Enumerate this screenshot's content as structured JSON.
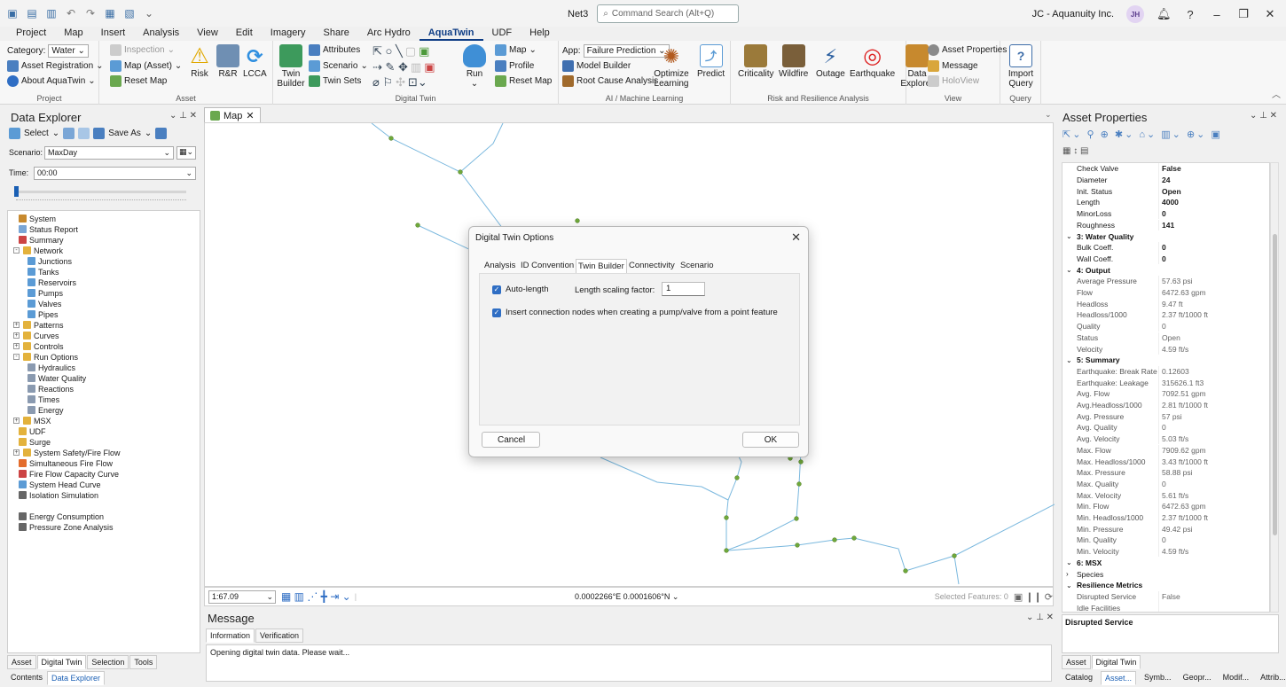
{
  "titlebar": {
    "project": "Net3",
    "search_placeholder": "Command Search (Alt+Q)",
    "account": "JC - Aquanuity Inc.",
    "initials": "JH"
  },
  "menu": [
    "Project",
    "Map",
    "Insert",
    "Analysis",
    "View",
    "Edit",
    "Imagery",
    "Share",
    "Arc Hydro",
    "AquaTwin",
    "UDF",
    "Help"
  ],
  "ribbon": {
    "project": {
      "category_label": "Category:",
      "category_value": "Water",
      "asset_registration": "Asset Registration",
      "about": "About AquaTwin",
      "group": "Project"
    },
    "asset": {
      "inspection": "Inspection",
      "map_asset": "Map (Asset)",
      "reset_map": "Reset Map",
      "risk": "Risk",
      "rr": "R&R",
      "lcca": "LCCA",
      "group": "Asset"
    },
    "digital_twin": {
      "twin_builder": "Twin Builder",
      "attributes": "Attributes",
      "scenario": "Scenario",
      "twin_sets": "Twin Sets",
      "group": "Digital Twin"
    },
    "run": {
      "run": "Run",
      "map": "Map",
      "profile": "Profile",
      "reset_map": "Reset Map"
    },
    "ai": {
      "app_label": "App:",
      "app_value": "Failure Prediction",
      "model_builder": "Model Builder",
      "root_cause": "Root Cause Analysis",
      "optimize": "Optimize Learning",
      "predict": "Predict",
      "group": "AI / Machine Learning"
    },
    "risk": {
      "criticality": "Criticality",
      "wildfire": "Wildfire",
      "outage": "Outage",
      "earthquake": "Earthquake",
      "group": "Risk and Resilience Analysis"
    },
    "view": {
      "data_explorer": "Data Explorer",
      "asset_properties": "Asset Properties",
      "message": "Message",
      "holoview": "HoloView",
      "group": "View"
    },
    "query": {
      "import_query": "Import Query",
      "group": "Query"
    }
  },
  "data_explorer": {
    "title": "Data Explorer",
    "toolbar": {
      "select": "Select",
      "save_as": "Save As"
    },
    "scenario_label": "Scenario:",
    "scenario_value": "MaxDay",
    "time_label": "Time:",
    "time_value": "00:00",
    "tree": [
      "System",
      "Status Report",
      "Summary",
      "Network",
      "Junctions",
      "Tanks",
      "Reservoirs",
      "Pumps",
      "Valves",
      "Pipes",
      "Patterns",
      "Curves",
      "Controls",
      "Run Options",
      "Hydraulics",
      "Water Quality",
      "Reactions",
      "Times",
      "Energy",
      "MSX",
      "UDF",
      "Surge",
      "System Safety/Fire Flow",
      "Simultaneous Fire Flow",
      "Fire Flow Capacity Curve",
      "System Head Curve",
      "Isolation Simulation",
      "Energy Consumption",
      "Pressure Zone Analysis"
    ],
    "tabs": [
      "Asset",
      "Digital Twin",
      "Selection",
      "Tools"
    ],
    "bottom_tabs": [
      "Contents",
      "Data Explorer"
    ]
  },
  "map": {
    "tab": "Map",
    "scale": "1:67.09",
    "coords": "0.0002266°E 0.0001606°N",
    "selected": "Selected Features: 0"
  },
  "dialog": {
    "title": "Digital Twin Options",
    "tabs": [
      "Analysis",
      "ID Convention",
      "Twin Builder",
      "Connectivity",
      "Scenario"
    ],
    "auto_length": "Auto-length",
    "scaling_label": "Length scaling factor:",
    "scaling_value": "1",
    "insert_nodes": "Insert connection nodes when creating a pump/valve from a point feature",
    "cancel": "Cancel",
    "ok": "OK"
  },
  "message": {
    "title": "Message",
    "tabs": [
      "Information",
      "Verification"
    ],
    "text": "Opening digital twin data.  Please wait..."
  },
  "asset_properties": {
    "title": "Asset Properties",
    "rows": [
      {
        "k": "Check Valve",
        "v": "False",
        "b": true
      },
      {
        "k": "Diameter",
        "v": "24",
        "b": true
      },
      {
        "k": "Init. Status",
        "v": "Open",
        "b": true
      },
      {
        "k": "Length",
        "v": "4000",
        "b": true
      },
      {
        "k": "MinorLoss",
        "v": "0",
        "b": true
      },
      {
        "k": "Roughness",
        "v": "141",
        "b": true
      },
      {
        "s": "3: Water Quality",
        "open": true
      },
      {
        "k": "Bulk Coeff.",
        "v": "0",
        "b": true
      },
      {
        "k": "Wall Coeff.",
        "v": "0",
        "b": true
      },
      {
        "s": "4: Output",
        "open": true
      },
      {
        "k": "Average Pressure",
        "v": "57.63 psi",
        "g": true
      },
      {
        "k": "Flow",
        "v": "6472.63 gpm",
        "g": true
      },
      {
        "k": "Headloss",
        "v": "9.47 ft",
        "g": true
      },
      {
        "k": "Headloss/1000",
        "v": "2.37 ft/1000 ft",
        "g": true
      },
      {
        "k": "Quality",
        "v": "0",
        "g": true
      },
      {
        "k": "Status",
        "v": "Open",
        "g": true
      },
      {
        "k": "Velocity",
        "v": "4.59 ft/s",
        "g": true
      },
      {
        "s": "5: Summary",
        "open": true
      },
      {
        "k": "Earthquake: Break Rate",
        "v": "0.12603",
        "g": true
      },
      {
        "k": "Earthquake: Leakage",
        "v": "315626.1 ft3",
        "g": true
      },
      {
        "k": "Avg. Flow",
        "v": "7092.51 gpm",
        "g": true
      },
      {
        "k": "Avg.Headloss/1000",
        "v": "2.81 ft/1000 ft",
        "g": true
      },
      {
        "k": "Avg. Pressure",
        "v": "57 psi",
        "g": true
      },
      {
        "k": "Avg. Quality",
        "v": "0",
        "g": true
      },
      {
        "k": "Avg. Velocity",
        "v": "5.03 ft/s",
        "g": true
      },
      {
        "k": "Max. Flow",
        "v": "7909.62 gpm",
        "g": true
      },
      {
        "k": "Max. Headloss/1000",
        "v": "3.43 ft/1000 ft",
        "g": true
      },
      {
        "k": "Max. Pressure",
        "v": "58.88 psi",
        "g": true
      },
      {
        "k": "Max. Quality",
        "v": "0",
        "g": true
      },
      {
        "k": "Max. Velocity",
        "v": "5.61 ft/s",
        "g": true
      },
      {
        "k": "Min. Flow",
        "v": "6472.63 gpm",
        "g": true
      },
      {
        "k": "Min. Headloss/1000",
        "v": "2.37 ft/1000 ft",
        "g": true
      },
      {
        "k": "Min. Pressure",
        "v": "49.42 psi",
        "g": true
      },
      {
        "k": "Min. Quality",
        "v": "0",
        "g": true
      },
      {
        "k": "Min. Velocity",
        "v": "4.59 ft/s",
        "g": true
      },
      {
        "s": "6: MSX",
        "open": true
      },
      {
        "s": "Species",
        "open": false,
        "plain": true
      },
      {
        "s": "Resilience Metrics",
        "open": true
      },
      {
        "k": "Disrupted Service",
        "v": "False",
        "g": true
      },
      {
        "k": "Idle Facilities",
        "v": "",
        "g": true
      }
    ],
    "description": "Disrupted Service",
    "tabs": [
      "Asset",
      "Digital Twin"
    ],
    "bottom_tabs": [
      "Catalog",
      "Asset...",
      "Symb...",
      "Geopr...",
      "Modif...",
      "Attrib..."
    ]
  },
  "colors": {
    "accent": "#2f6ec4",
    "pipe": "#7ab8de",
    "node": "#6fa83a"
  }
}
